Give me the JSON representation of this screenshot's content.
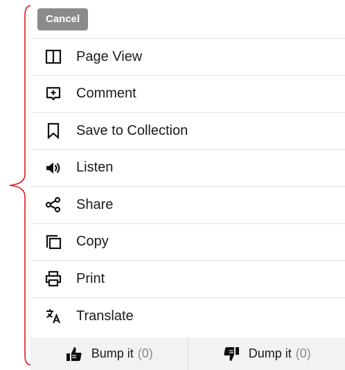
{
  "annotation": {
    "brace_color": "#d7191f"
  },
  "cancel": {
    "label": "Cancel",
    "bg_color": "#8b8b8b"
  },
  "menu": {
    "items": [
      {
        "label": "Page View",
        "icon": "page-view-icon"
      },
      {
        "label": "Comment",
        "icon": "comment-icon"
      },
      {
        "label": "Save to Collection",
        "icon": "bookmark-icon"
      },
      {
        "label": "Listen",
        "icon": "speaker-icon"
      },
      {
        "label": "Share",
        "icon": "share-icon"
      },
      {
        "label": "Copy",
        "icon": "copy-icon"
      },
      {
        "label": "Print",
        "icon": "print-icon"
      },
      {
        "label": "Translate",
        "icon": "translate-icon"
      }
    ]
  },
  "votes": {
    "bump": {
      "label": "Bump it",
      "count": "(0)",
      "icon": "thumbs-up-icon"
    },
    "dump": {
      "label": "Dump it",
      "count": "(0)",
      "icon": "thumbs-down-icon"
    }
  }
}
